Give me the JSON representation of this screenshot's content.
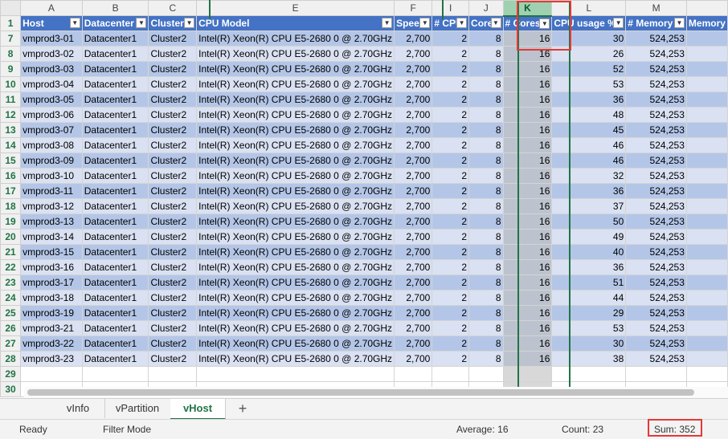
{
  "column_letters": [
    "A",
    "B",
    "C",
    "E",
    "F",
    "I",
    "J",
    "K",
    "L",
    "M",
    ""
  ],
  "header_row_num": "1",
  "headers": [
    "Host",
    "Datacenter",
    "Cluster",
    "CPU Model",
    "Speed",
    "# CPU",
    "Cores",
    "# Cores",
    "CPU usage %",
    "# Memory",
    "Memory"
  ],
  "rows": [
    {
      "r": "7",
      "c": [
        "vmprod3-01",
        "Datacenter1",
        "Cluster2",
        "Intel(R) Xeon(R) CPU E5-2680 0 @ 2.70GHz",
        "2,700",
        "2",
        "8",
        "16",
        "30",
        "524,253"
      ]
    },
    {
      "r": "8",
      "c": [
        "vmprod3-02",
        "Datacenter1",
        "Cluster2",
        "Intel(R) Xeon(R) CPU E5-2680 0 @ 2.70GHz",
        "2,700",
        "2",
        "8",
        "16",
        "26",
        "524,253"
      ]
    },
    {
      "r": "9",
      "c": [
        "vmprod3-03",
        "Datacenter1",
        "Cluster2",
        "Intel(R) Xeon(R) CPU E5-2680 0 @ 2.70GHz",
        "2,700",
        "2",
        "8",
        "16",
        "52",
        "524,253"
      ]
    },
    {
      "r": "10",
      "c": [
        "vmprod3-04",
        "Datacenter1",
        "Cluster2",
        "Intel(R) Xeon(R) CPU E5-2680 0 @ 2.70GHz",
        "2,700",
        "2",
        "8",
        "16",
        "53",
        "524,253"
      ]
    },
    {
      "r": "11",
      "c": [
        "vmprod3-05",
        "Datacenter1",
        "Cluster2",
        "Intel(R) Xeon(R) CPU E5-2680 0 @ 2.70GHz",
        "2,700",
        "2",
        "8",
        "16",
        "36",
        "524,253"
      ]
    },
    {
      "r": "12",
      "c": [
        "vmprod3-06",
        "Datacenter1",
        "Cluster2",
        "Intel(R) Xeon(R) CPU E5-2680 0 @ 2.70GHz",
        "2,700",
        "2",
        "8",
        "16",
        "48",
        "524,253"
      ]
    },
    {
      "r": "13",
      "c": [
        "vmprod3-07",
        "Datacenter1",
        "Cluster2",
        "Intel(R) Xeon(R) CPU E5-2680 0 @ 2.70GHz",
        "2,700",
        "2",
        "8",
        "16",
        "45",
        "524,253"
      ]
    },
    {
      "r": "14",
      "c": [
        "vmprod3-08",
        "Datacenter1",
        "Cluster2",
        "Intel(R) Xeon(R) CPU E5-2680 0 @ 2.70GHz",
        "2,700",
        "2",
        "8",
        "16",
        "46",
        "524,253"
      ]
    },
    {
      "r": "15",
      "c": [
        "vmprod3-09",
        "Datacenter1",
        "Cluster2",
        "Intel(R) Xeon(R) CPU E5-2680 0 @ 2.70GHz",
        "2,700",
        "2",
        "8",
        "16",
        "46",
        "524,253"
      ]
    },
    {
      "r": "16",
      "c": [
        "vmprod3-10",
        "Datacenter1",
        "Cluster2",
        "Intel(R) Xeon(R) CPU E5-2680 0 @ 2.70GHz",
        "2,700",
        "2",
        "8",
        "16",
        "32",
        "524,253"
      ]
    },
    {
      "r": "17",
      "c": [
        "vmprod3-11",
        "Datacenter1",
        "Cluster2",
        "Intel(R) Xeon(R) CPU E5-2680 0 @ 2.70GHz",
        "2,700",
        "2",
        "8",
        "16",
        "36",
        "524,253"
      ]
    },
    {
      "r": "18",
      "c": [
        "vmprod3-12",
        "Datacenter1",
        "Cluster2",
        "Intel(R) Xeon(R) CPU E5-2680 0 @ 2.70GHz",
        "2,700",
        "2",
        "8",
        "16",
        "37",
        "524,253"
      ]
    },
    {
      "r": "19",
      "c": [
        "vmprod3-13",
        "Datacenter1",
        "Cluster2",
        "Intel(R) Xeon(R) CPU E5-2680 0 @ 2.70GHz",
        "2,700",
        "2",
        "8",
        "16",
        "50",
        "524,253"
      ]
    },
    {
      "r": "20",
      "c": [
        "vmprod3-14",
        "Datacenter1",
        "Cluster2",
        "Intel(R) Xeon(R) CPU E5-2680 0 @ 2.70GHz",
        "2,700",
        "2",
        "8",
        "16",
        "49",
        "524,253"
      ]
    },
    {
      "r": "21",
      "c": [
        "vmprod3-15",
        "Datacenter1",
        "Cluster2",
        "Intel(R) Xeon(R) CPU E5-2680 0 @ 2.70GHz",
        "2,700",
        "2",
        "8",
        "16",
        "40",
        "524,253"
      ]
    },
    {
      "r": "22",
      "c": [
        "vmprod3-16",
        "Datacenter1",
        "Cluster2",
        "Intel(R) Xeon(R) CPU E5-2680 0 @ 2.70GHz",
        "2,700",
        "2",
        "8",
        "16",
        "36",
        "524,253"
      ]
    },
    {
      "r": "23",
      "c": [
        "vmprod3-17",
        "Datacenter1",
        "Cluster2",
        "Intel(R) Xeon(R) CPU E5-2680 0 @ 2.70GHz",
        "2,700",
        "2",
        "8",
        "16",
        "51",
        "524,253"
      ]
    },
    {
      "r": "24",
      "c": [
        "vmprod3-18",
        "Datacenter1",
        "Cluster2",
        "Intel(R) Xeon(R) CPU E5-2680 0 @ 2.70GHz",
        "2,700",
        "2",
        "8",
        "16",
        "44",
        "524,253"
      ]
    },
    {
      "r": "25",
      "c": [
        "vmprod3-19",
        "Datacenter1",
        "Cluster2",
        "Intel(R) Xeon(R) CPU E5-2680 0 @ 2.70GHz",
        "2,700",
        "2",
        "8",
        "16",
        "29",
        "524,253"
      ]
    },
    {
      "r": "26",
      "c": [
        "vmprod3-21",
        "Datacenter1",
        "Cluster2",
        "Intel(R) Xeon(R) CPU E5-2680 0 @ 2.70GHz",
        "2,700",
        "2",
        "8",
        "16",
        "53",
        "524,253"
      ]
    },
    {
      "r": "27",
      "c": [
        "vmprod3-22",
        "Datacenter1",
        "Cluster2",
        "Intel(R) Xeon(R) CPU E5-2680 0 @ 2.70GHz",
        "2,700",
        "2",
        "8",
        "16",
        "30",
        "524,253"
      ]
    },
    {
      "r": "28",
      "c": [
        "vmprod3-23",
        "Datacenter1",
        "Cluster2",
        "Intel(R) Xeon(R) CPU E5-2680 0 @ 2.70GHz",
        "2,700",
        "2",
        "8",
        "16",
        "38",
        "524,253"
      ]
    }
  ],
  "blank_rows": [
    "29",
    "30"
  ],
  "tabs": [
    "vInfo",
    "vPartition",
    "vHost"
  ],
  "active_tab": "vHost",
  "add_sheet_label": "+",
  "status": {
    "ready": "Ready",
    "mode": "Filter Mode",
    "average": "Average: 16",
    "count": "Count: 23",
    "sum": "Sum: 352"
  },
  "colors": {
    "header_fill": "#4472c4",
    "band_dark": "#b4c6e7",
    "band_light": "#d9e1f2",
    "excel_green": "#217346",
    "highlight_red": "#e53935"
  }
}
